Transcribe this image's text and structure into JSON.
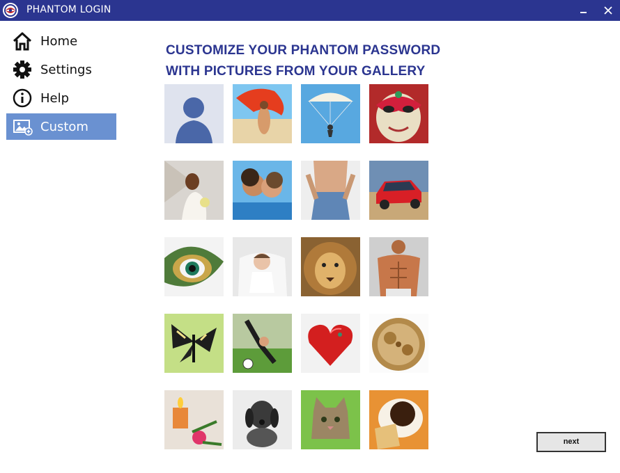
{
  "window": {
    "title": "PHANTOM LOGIN",
    "minimize_glyph": "‒",
    "close_glyph": "✕"
  },
  "sidebar": {
    "items": [
      {
        "label": "Home",
        "icon": "home-icon"
      },
      {
        "label": "Settings",
        "icon": "gear-icon"
      },
      {
        "label": "Help",
        "icon": "info-icon"
      },
      {
        "label": "Custom",
        "icon": "image-add-icon",
        "active": true
      }
    ]
  },
  "main": {
    "heading_line1": "CUSTOMIZE YOUR PHANTOM PASSWORD",
    "heading_line2": "WITH PICTURES FROM YOUR GALLERY"
  },
  "gallery": [
    "person-silhouette",
    "woman-red-scarf",
    "parachutist",
    "venetian-mask",
    "bride",
    "couple-kissing",
    "jeans-torso",
    "rally-car",
    "peacock-eye",
    "baby",
    "lion",
    "muscular-man",
    "butterfly",
    "soccer-kid",
    "red-heart-box",
    "pocket-watch",
    "candle-rose",
    "puppy",
    "kitten",
    "coffee-cookie"
  ],
  "actions": {
    "next_label": "next"
  },
  "colors": {
    "titlebar": "#2b3590",
    "heading": "#2b3590",
    "active_nav": "#6a91d1"
  }
}
